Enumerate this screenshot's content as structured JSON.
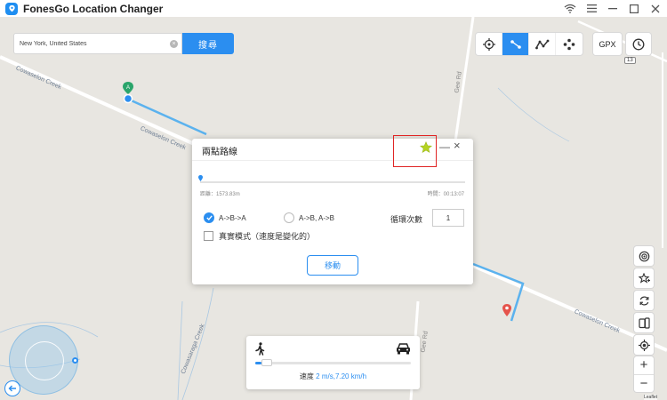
{
  "window": {
    "title": "FonesGo Location Changer"
  },
  "search": {
    "value": "New York, United States",
    "button_label": "搜尋"
  },
  "toolbar": {
    "gpx_label": "GPX"
  },
  "map": {
    "labels": {
      "cowaselon_creek_1": "Cowaselon Creek",
      "cowaselon_creek_2": "Cowaselon Creek",
      "cowaselon_creek_3": "Cowaselon Creek",
      "cowasaraga_creek": "Cowasaraga Creek",
      "gee_rd_top": "Gee Rd",
      "gee_rd_bottom": "Gee Rd",
      "route_13": "13",
      "rd_top_right": "Rd"
    },
    "markers": {
      "a_label": "A"
    },
    "attribution": "Leaflet"
  },
  "dialog": {
    "title": "兩點路線",
    "distance": "距離：1573.83m",
    "time": "時間：00:13:07",
    "mode_option_1": "A->B->A",
    "mode_option_2": "A->B, A->B",
    "loop_label": "循環次數",
    "loop_value": "1",
    "realistic_label": "真實模式（速度是變化的）",
    "move_button": "移動"
  },
  "speed": {
    "label": "速度",
    "value": "2 m/s,7.20 km/h",
    "level": 0.04
  },
  "colors": {
    "accent": "#2b8ef0",
    "highlight": "#e02424",
    "star": "#b5d322"
  }
}
